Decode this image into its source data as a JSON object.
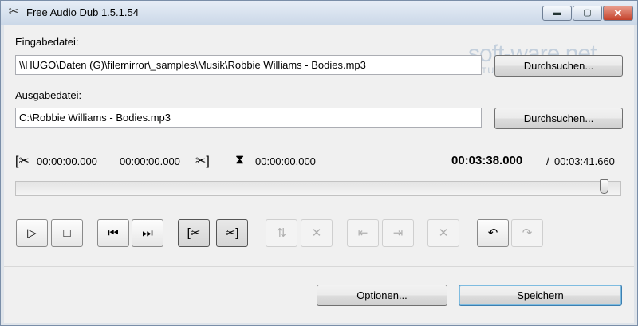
{
  "window": {
    "title": "Free Audio Dub 1.5.1.54",
    "icons": {
      "app": "scissors-icon",
      "min": "minimize-icon",
      "max": "maximize-icon",
      "close": "close-icon"
    },
    "glyphs": {
      "app": "✂",
      "min": "▬",
      "max": "▢",
      "close": "✕"
    }
  },
  "watermark": {
    "line1": "soft-ware.net",
    "line2": "AKTUELLE DOWNLOADS"
  },
  "input": {
    "label": "Eingabedatei:",
    "value": "\\\\HUGO\\Daten (G)\\filemirror\\_samples\\Musik\\Robbie Williams - Bodies.mp3",
    "browse_label": "Durchsuchen..."
  },
  "output": {
    "label": "Ausgabedatei:",
    "value": "C:\\Robbie Williams - Bodies.mp3",
    "browse_label": "Durchsuchen..."
  },
  "times": {
    "cut_start_icon": "[✂",
    "cut_start": "00:00:00.000",
    "cut_end": "00:00:00.000",
    "cut_end_icon": "✂]",
    "marker_icon": "⧗",
    "marker": "00:00:00.000",
    "position": "00:03:38.000",
    "sep": "/",
    "total": "00:03:41.660"
  },
  "slider": {
    "position_fraction": 0.985
  },
  "toolbar": [
    {
      "name": "play-button",
      "icon": "play-icon",
      "glyph": "▷",
      "disabled": false
    },
    {
      "name": "stop-button",
      "icon": "stop-icon",
      "glyph": "□",
      "disabled": false
    },
    {
      "name": "prev-button",
      "icon": "skip-back-icon",
      "glyph": "⏮",
      "disabled": false
    },
    {
      "name": "next-button",
      "icon": "skip-forward-icon",
      "glyph": "⏭",
      "disabled": false
    },
    {
      "name": "set-cut-start-button",
      "icon": "cut-start-icon",
      "glyph": "[✂",
      "disabled": false
    },
    {
      "name": "set-cut-end-button",
      "icon": "cut-end-icon",
      "glyph": "✂]",
      "disabled": false
    },
    {
      "name": "join-button",
      "icon": "join-icon",
      "glyph": "⇅",
      "disabled": true
    },
    {
      "name": "remove-cut-button",
      "icon": "remove-cut-icon",
      "glyph": "✕",
      "disabled": true
    },
    {
      "name": "goto-start-button",
      "icon": "goto-start-icon",
      "glyph": "⇤",
      "disabled": true
    },
    {
      "name": "goto-end-button",
      "icon": "goto-end-icon",
      "glyph": "⇥",
      "disabled": true
    },
    {
      "name": "delete-button",
      "icon": "delete-icon",
      "glyph": "✕",
      "disabled": true
    },
    {
      "name": "undo-button",
      "icon": "undo-icon",
      "glyph": "↶",
      "disabled": false
    },
    {
      "name": "redo-button",
      "icon": "redo-icon",
      "glyph": "↷",
      "disabled": true
    }
  ],
  "footer": {
    "options_label": "Optionen...",
    "save_label": "Speichern"
  }
}
